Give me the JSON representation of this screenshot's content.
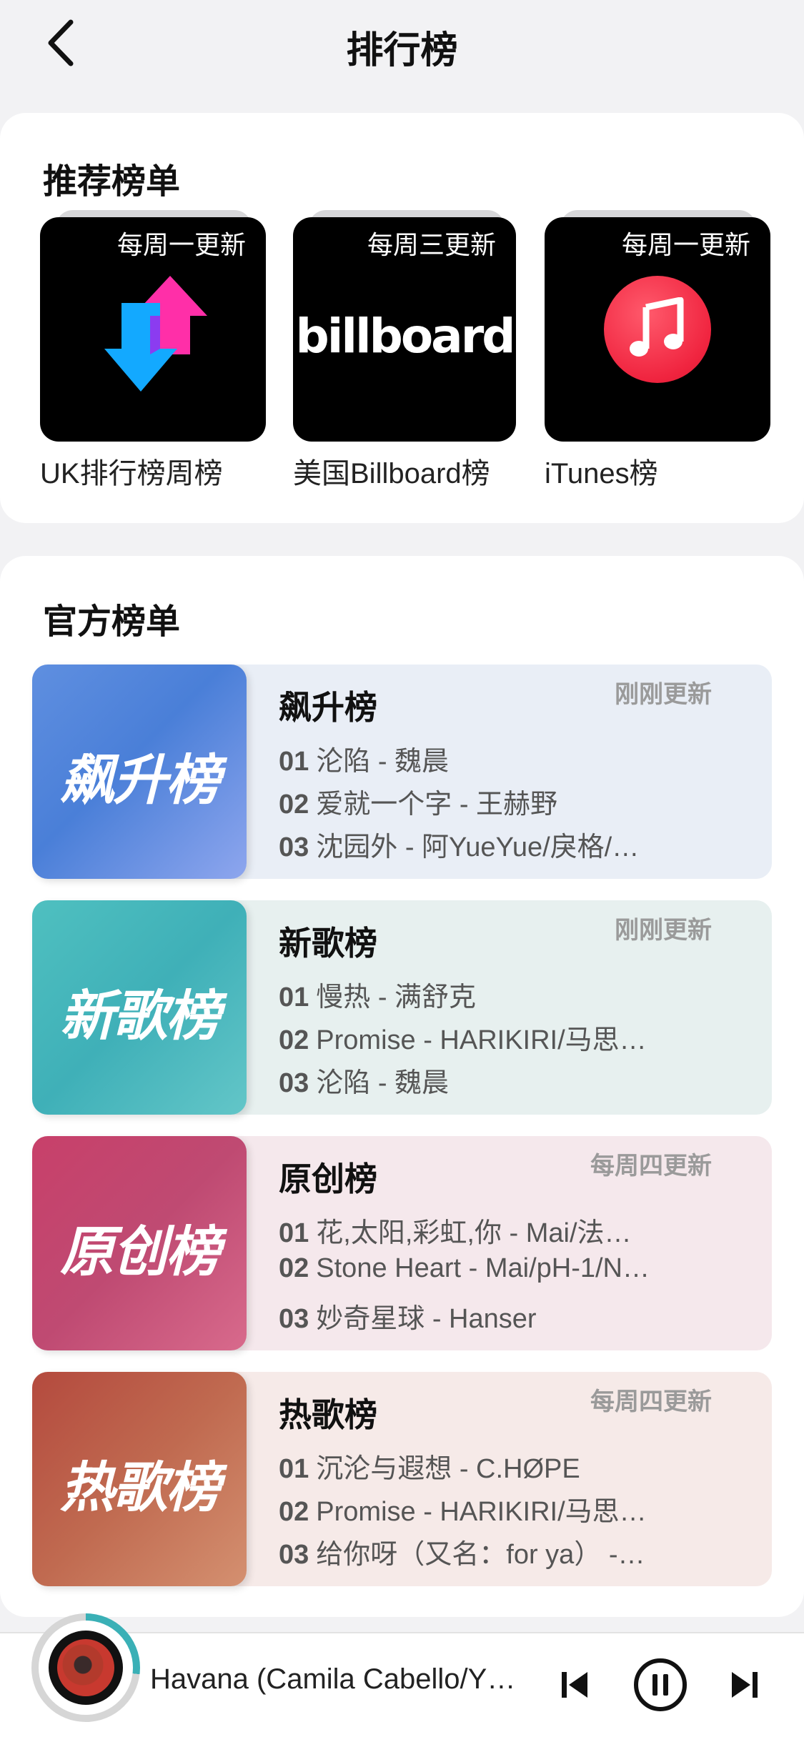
{
  "header": {
    "title": "排行榜"
  },
  "recommended": {
    "title": "推荐榜单",
    "items": [
      {
        "name": "UK排行榜周榜",
        "update": "每周一更新",
        "icon": "arrows-icon"
      },
      {
        "name": "美国Billboard榜",
        "update": "每周三更新",
        "logo_text": "billboard"
      },
      {
        "name": "iTunes榜",
        "update": "每周一更新",
        "icon": "music-note-icon"
      }
    ]
  },
  "official": {
    "title": "官方榜单",
    "charts": [
      {
        "title": "飙升榜",
        "cover_text": "飙升榜",
        "update": "刚刚更新",
        "tracks": [
          {
            "num": "01",
            "text": "沦陷 - 魏晨"
          },
          {
            "num": "02",
            "text": "爱就一个字 - 王赫野"
          },
          {
            "num": "03",
            "text": "沈园外 - 阿YueYue/戾格/…"
          }
        ]
      },
      {
        "title": "新歌榜",
        "cover_text": "新歌榜",
        "update": "刚刚更新",
        "tracks": [
          {
            "num": "01",
            "text": "慢热 - 满舒克"
          },
          {
            "num": "02",
            "text": "Promise - HARIKIRI/马思…"
          },
          {
            "num": "03",
            "text": "沦陷 - 魏晨"
          }
        ]
      },
      {
        "title": "原创榜",
        "cover_text": "原创榜",
        "update": "每周四更新",
        "tracks": [
          {
            "num": "01",
            "text": "花,太阳,彩虹,你 - Mai/法…"
          },
          {
            "num": "02",
            "text": "Stone Heart - Mai/pH-1/N…"
          },
          {
            "num": "03",
            "text": "妙奇星球 - Hanser"
          }
        ]
      },
      {
        "title": "热歌榜",
        "cover_text": "热歌榜",
        "update": "每周四更新",
        "tracks": [
          {
            "num": "01",
            "text": "沉沦与遐想 - C.HØPE"
          },
          {
            "num": "02",
            "text": "Promise - HARIKIRI/马思…"
          },
          {
            "num": "03",
            "text": "给你呀（又名：for ya） -…"
          }
        ]
      }
    ]
  },
  "player": {
    "song": "Havana (Camila Cabello/Y…",
    "progress": 0.27,
    "accent": "#3ab0b6",
    "controls": [
      "previous-icon",
      "pause-icon",
      "next-icon"
    ]
  }
}
